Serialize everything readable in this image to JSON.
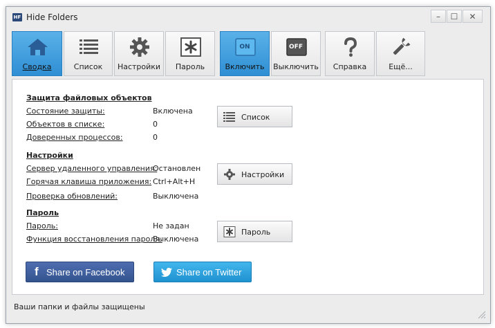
{
  "window": {
    "title": "Hide Folders",
    "app_icon_text": "HF"
  },
  "window_controls": {
    "minimize": "–",
    "maximize": "☐",
    "close": "✕"
  },
  "toolbar": [
    {
      "id": "summary",
      "label": "Сводка",
      "icon": "home-icon"
    },
    {
      "id": "list",
      "label": "Список",
      "icon": "list-icon"
    },
    {
      "id": "settings",
      "label": "Настройки",
      "icon": "gear-icon"
    },
    {
      "id": "password",
      "label": "Пароль",
      "icon": "asterisk-icon"
    },
    {
      "id": "enable",
      "label": "Включить",
      "icon": "on-icon",
      "icon_text": "ON"
    },
    {
      "id": "disable",
      "label": "Выключить",
      "icon": "off-icon",
      "icon_text": "OFF"
    },
    {
      "id": "help",
      "label": "Справка",
      "icon": "question-icon"
    },
    {
      "id": "more",
      "label": "Ещё...",
      "icon": "wrench-icon"
    }
  ],
  "protection": {
    "title": "Защита файловых объектов",
    "rows": [
      {
        "label": "Состояние защиты:",
        "value": "Включена"
      },
      {
        "label": "Объектов в списке:",
        "value": "0"
      },
      {
        "label": "Доверенных процессов:",
        "value": "0"
      }
    ],
    "button": "Список"
  },
  "settings": {
    "title": "Настройки",
    "rows": [
      {
        "label": "Сервер удаленного управления:",
        "value": "Остановлен"
      },
      {
        "label": "Горячая клавиша приложения:",
        "value": "Ctrl+Alt+H"
      },
      {
        "label": "Проверка обновлений:",
        "value": "Выключена"
      }
    ],
    "button": "Настройки"
  },
  "password": {
    "title": "Пароль",
    "rows": [
      {
        "label": "Пароль:",
        "value": "Не задан"
      },
      {
        "label": "Функция восстановления пароля:",
        "value": "Выключена"
      }
    ],
    "button": "Пароль"
  },
  "share": {
    "facebook": "Share on Facebook",
    "facebook_icon": "f",
    "twitter": "Share on Twitter"
  },
  "status": {
    "text": "Ваши папки и файлы защищены"
  },
  "colors": {
    "active_tab": "#2f8fd4",
    "facebook": "#3b5998",
    "twitter": "#1da1f2"
  }
}
